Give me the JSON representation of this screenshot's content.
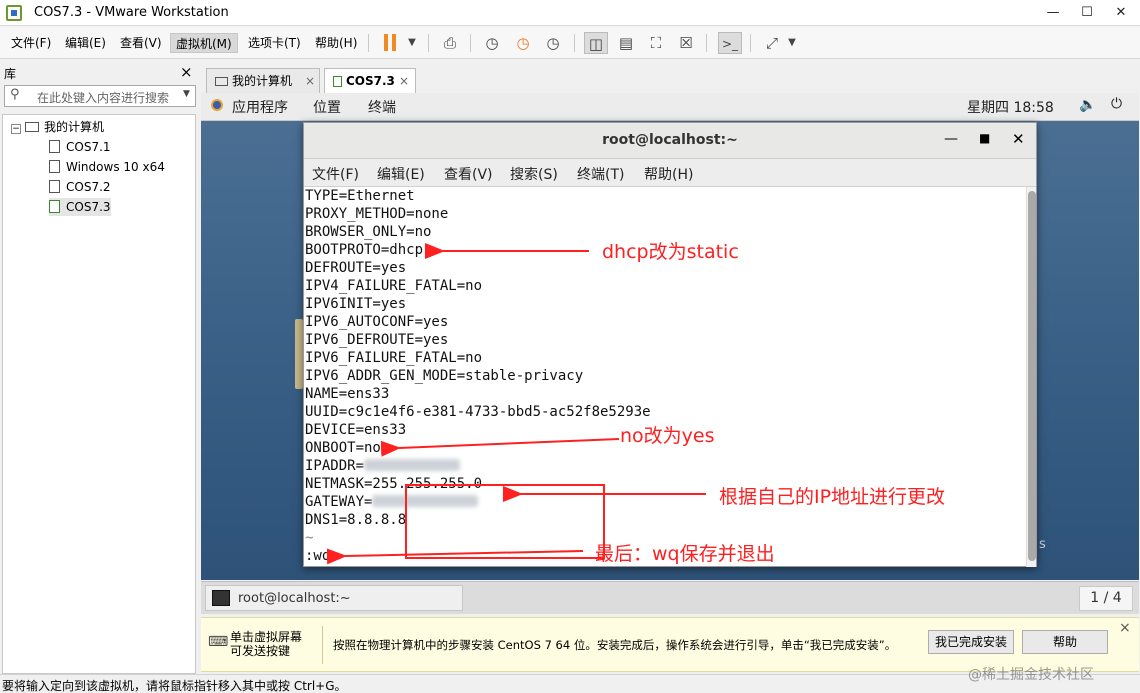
{
  "window": {
    "title": "COS7.3 - VMware Workstation"
  },
  "menu": [
    "文件(F)",
    "编辑(E)",
    "查看(V)",
    "虚拟机(M)",
    "选项卡(T)",
    "帮助(H)"
  ],
  "library": {
    "title": "库",
    "close": "×",
    "search_placeholder": "在此处键入内容进行搜索",
    "root": "我的计算机",
    "vms": [
      "COS7.1",
      "Windows 10 x64",
      "COS7.2",
      "COS7.3"
    ]
  },
  "tabs": [
    {
      "label": "我的计算机"
    },
    {
      "label": "COS7.3"
    }
  ],
  "gnome": {
    "apps": "应用程序",
    "places": "位置",
    "terminal": "终端",
    "clock": "星期四 18:58"
  },
  "terminal": {
    "title": "root@localhost:~",
    "menu": [
      "文件(F)",
      "编辑(E)",
      "查看(V)",
      "搜索(S)",
      "终端(T)",
      "帮助(H)"
    ],
    "lines": [
      "TYPE=Ethernet",
      "PROXY_METHOD=none",
      "BROWSER_ONLY=no",
      "BOOTPROTO=dhcp",
      "DEFROUTE=yes",
      "IPV4_FAILURE_FATAL=no",
      "IPV6INIT=yes",
      "IPV6_AUTOCONF=yes",
      "IPV6_DEFROUTE=yes",
      "IPV6_FAILURE_FATAL=no",
      "IPV6_ADDR_GEN_MODE=stable-privacy",
      "NAME=ens33",
      "UUID=c9c1e4f6-e381-4733-bbd5-ac52f8e5293e",
      "DEVICE=ens33",
      "ONBOOT=no",
      "IPADDR=",
      "NETMASK=255.255.255.0",
      "GATEWAY=",
      "DNS1=8.8.8.8",
      "~",
      ":wq"
    ]
  },
  "annotations": {
    "bootproto": "dhcp改为static",
    "onboot": "no改为yes",
    "ip": "根据自己的IP地址进行更改",
    "save": "最后：wq保存并退出"
  },
  "taskbar": {
    "item": "root@localhost:~",
    "pager": "1 / 4"
  },
  "hint": {
    "left": "单击虚拟屏幕\n可发送按键",
    "message": "按照在物理计算机中的步骤安装 CentOS 7 64 位。安装完成后，操作系统会进行引导，单击“我已完成安装”。",
    "done_button": "我已完成安装",
    "help_button": "帮助",
    "close": "×"
  },
  "status": "要将输入定向到该虚拟机，请将鼠标指针移入其中或按 Ctrl+G。",
  "watermark": "@稀土掘金技术社区",
  "colors": {
    "annotation": "#ff1f1f",
    "pause": "#f08a24",
    "desktop": "#3b5f86"
  }
}
